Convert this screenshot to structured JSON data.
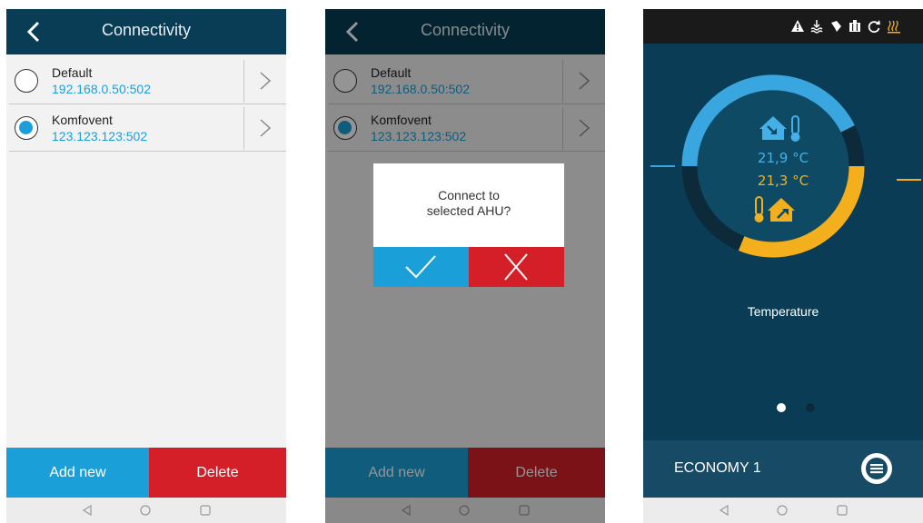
{
  "screen1": {
    "header_title": "Connectivity",
    "items": [
      {
        "name": "Default",
        "address": "192.168.0.50:502",
        "selected": false
      },
      {
        "name": "Komfovent",
        "address": "123.123.123:502",
        "selected": true
      }
    ],
    "add_label": "Add new",
    "delete_label": "Delete"
  },
  "screen2": {
    "header_title": "Connectivity",
    "items": [
      {
        "name": "Default",
        "address": "192.168.0.50:502",
        "selected": false
      },
      {
        "name": "Komfovent",
        "address": "123.123.123:502",
        "selected": true
      }
    ],
    "dialog_line1": "Connect to",
    "dialog_line2": "selected AHU?",
    "add_label": "Add new",
    "delete_label": "Delete"
  },
  "screen3": {
    "status_icons": [
      "warning-icon",
      "heating-icon",
      "fan-icon",
      "filter-icon",
      "recirculation-icon",
      "heater-icon"
    ],
    "indoor_temp": "21,9 °C",
    "outdoor_temp": "21,3 °C",
    "gauge_label": "Temperature",
    "mode": "ECONOMY 1",
    "page_count": 2,
    "active_page": 1
  },
  "colors": {
    "header": "#083d55",
    "accent_blue": "#1b9fd8",
    "accent_red": "#d41f28",
    "dashboard_bg": "#0a3d55",
    "gauge_blue": "#3aa6e0",
    "gauge_yellow": "#f3b01c"
  }
}
